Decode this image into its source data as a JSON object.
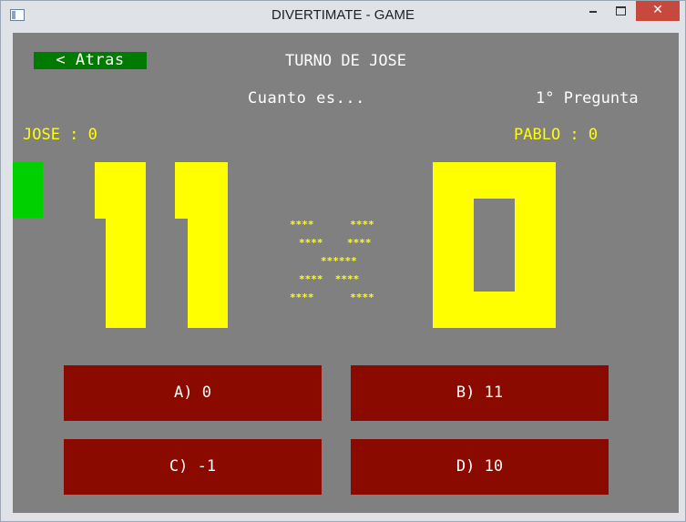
{
  "window": {
    "title": "DIVERTIMATE - GAME",
    "close_glyph": "✕"
  },
  "game": {
    "back_label": "< Atras",
    "turn_text": "TURNO DE JOSE",
    "question_prompt": "Cuanto es...",
    "question_number": "1° Pregunta",
    "players": [
      {
        "label": "JOSE : 0"
      },
      {
        "label": "PABLO : 0"
      }
    ],
    "expression": {
      "operand1": "11",
      "operator": "÷",
      "operand2": "0",
      "operator_rows": [
        "****      ****",
        "****    ****",
        "******",
        "****  ****",
        "****      ****"
      ]
    },
    "answers": [
      {
        "label": "A) 0"
      },
      {
        "label": "B) 11"
      },
      {
        "label": "C) -1"
      },
      {
        "label": "D) 10"
      }
    ]
  },
  "colors": {
    "background": "#808080",
    "digits": "#ffff00",
    "answer_button": "#8b0a00",
    "back_button": "#007a00",
    "turn_marker": "#00d000",
    "score_text": "#ffff00"
  }
}
